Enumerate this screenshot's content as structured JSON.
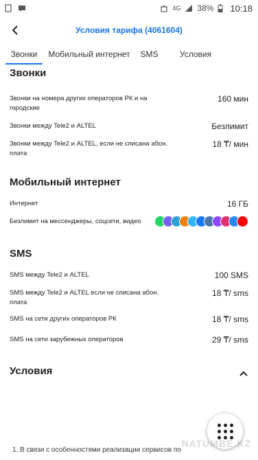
{
  "status_bar": {
    "battery_percent": "38%",
    "time": "10:18",
    "network": "4G"
  },
  "header": {
    "title": "Условия тарифа (4061604)"
  },
  "tabs": [
    {
      "label": "Звонки",
      "active": true
    },
    {
      "label": "Мобильный интернет",
      "active": false
    },
    {
      "label": "SMS",
      "active": false
    },
    {
      "label": "Условия",
      "active": false
    }
  ],
  "calls": {
    "title": "Звонки",
    "rows": [
      {
        "label": "Звонки на номера других операторов РК и на городские",
        "value": "160 мин"
      },
      {
        "label": "Звонки между Tele2 и ALTEL",
        "value": "Безлимит"
      },
      {
        "label": "Звонки между Tele2 и ALTEL, если не списана абон. плата",
        "value": "18 ₸/ мин"
      }
    ]
  },
  "internet": {
    "title": "Мобильный интернет",
    "rows": [
      {
        "label": "Интернет",
        "value": "16 ГБ"
      },
      {
        "label": "Безлимит на мессенджеры, соцсети, видео"
      }
    ],
    "apps": [
      {
        "name": "whatsapp-icon",
        "color": "#25d366"
      },
      {
        "name": "viber-icon",
        "color": "#7360f2"
      },
      {
        "name": "telegram-icon",
        "color": "#2aa1da"
      },
      {
        "name": "ok-icon",
        "color": "#ee8208"
      },
      {
        "name": "tamtam-icon",
        "color": "#30b7ff"
      },
      {
        "name": "facebook-icon",
        "color": "#1877f2"
      },
      {
        "name": "vk-icon",
        "color": "#4a76a8"
      },
      {
        "name": "twitch-icon",
        "color": "#9146ff"
      },
      {
        "name": "instagram-icon",
        "color": "#e1306c"
      },
      {
        "name": "vk-alt-icon",
        "color": "#2787f5"
      },
      {
        "name": "youtube-icon",
        "color": "#ff0000"
      }
    ]
  },
  "sms": {
    "title": "SMS",
    "rows": [
      {
        "label": "SMS между Tele2 и ALTEL",
        "value": "100 SMS"
      },
      {
        "label": "SMS между Tele2 и ALTEL если не списана абон. плата",
        "value": "18 ₸/ sms"
      },
      {
        "label": "SMS на сети других операторов РК",
        "value": "18 ₸/ sms"
      },
      {
        "label": "SMS на сети зарубежных операторов",
        "value": "29 ₸/ sms"
      }
    ]
  },
  "conditions": {
    "title": "Условия",
    "note": "1. В связи с особенностями реализации сервисов по"
  },
  "watermark": "NATUMBE.KZ"
}
